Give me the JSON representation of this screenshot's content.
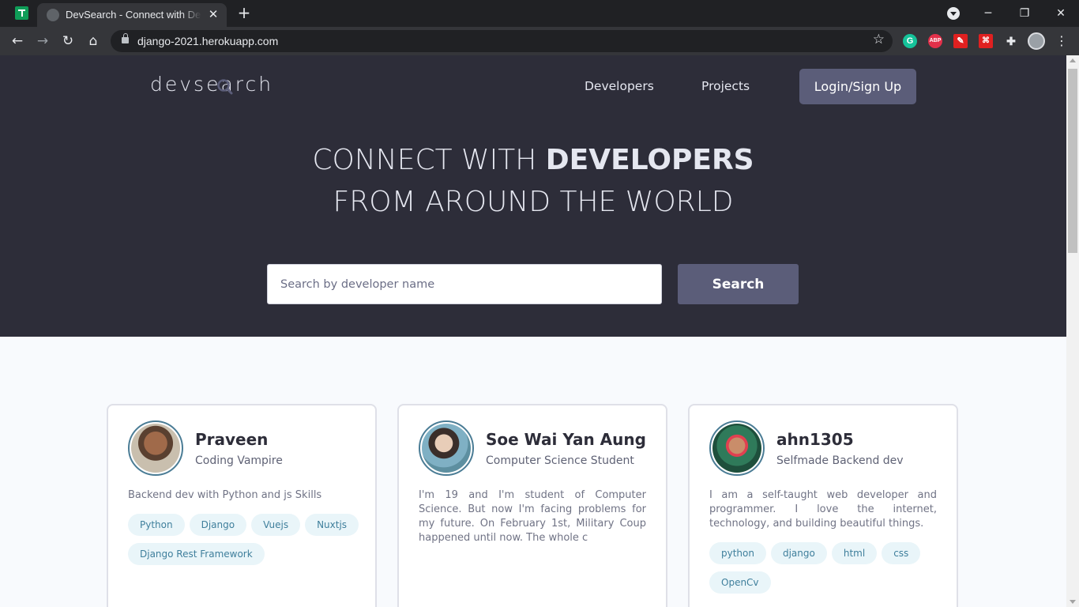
{
  "browser": {
    "tab_title": "DevSearch - Connect with Developers",
    "tab_close": "✕",
    "new_tab": "+",
    "url": "django-2021.herokuapp.com",
    "window_controls": {
      "minimize": "─",
      "maximize": "❐",
      "close": "✕"
    },
    "extensions": [
      {
        "name": "grammarly-icon",
        "label": "G",
        "color": "#15c39a"
      },
      {
        "name": "adblock-plus-icon",
        "label": "ABP",
        "color": "#e2304a"
      },
      {
        "name": "magic-wand-icon",
        "label": "✎",
        "color": "#e02020"
      },
      {
        "name": "acrobat-pdf-icon",
        "label": "⌘",
        "color": "#e02020"
      },
      {
        "name": "extensions-puzzle-icon",
        "label": "✚",
        "color": "#e8eaed"
      }
    ]
  },
  "site": {
    "logo": "devsearch",
    "nav": {
      "developers": "Developers",
      "projects": "Projects",
      "login": "Login/Sign Up"
    },
    "hero": {
      "line1_light": "CONNECT WITH ",
      "line1_strong": "DEVELOPERS",
      "line2": "FROM AROUND THE WORLD"
    },
    "search": {
      "placeholder": "Search by developer name",
      "button": "Search"
    },
    "colors": {
      "hero_bg": "#2d2d39",
      "accent": "#5b5d79",
      "tag_bg": "#e9f5f9",
      "tag_text": "#3f7f9c"
    }
  },
  "developers": [
    {
      "name": "Praveen",
      "title": "Coding Vampire",
      "bio": "Backend dev with Python and js Skills",
      "skills": [
        "Python",
        "Django",
        "Vuejs",
        "Nuxtjs",
        "Django Rest Framework"
      ]
    },
    {
      "name": "Soe Wai Yan Aung",
      "title": "Computer Science Student",
      "bio": "I'm 19 and I'm student of Computer Science. But now I'm facing problems for my future. On February 1st, Military Coup happened until now. The whole c",
      "skills": []
    },
    {
      "name": "ahn1305",
      "title": "Selfmade Backend dev",
      "bio": "I am a self-taught web developer and programmer. I love the internet, technology, and building beautiful things.",
      "skills": [
        "python",
        "django",
        "html",
        "css",
        "OpenCv"
      ]
    }
  ]
}
